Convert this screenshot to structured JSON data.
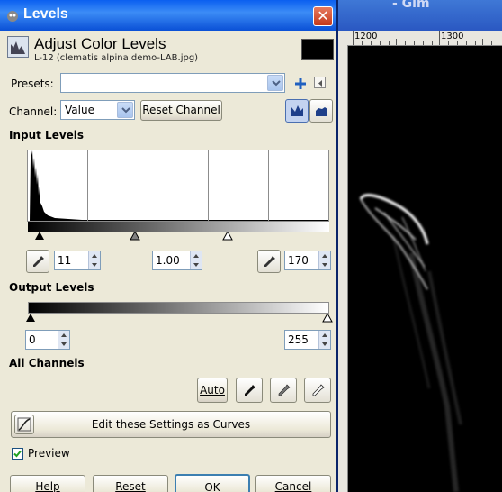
{
  "window": {
    "title": "Levels",
    "close": "✕"
  },
  "header": {
    "title": "Adjust Color Levels",
    "subtitle": "L-12 (clematis alpina demo-LAB.jpg)"
  },
  "presets": {
    "label": "Presets:",
    "value": ""
  },
  "channel": {
    "label": "Channel:",
    "value": "Value",
    "reset_label": "Reset Channel"
  },
  "input_levels": {
    "heading": "Input Levels",
    "low": "11",
    "gamma": "1.00",
    "high": "170"
  },
  "output_levels": {
    "heading": "Output Levels",
    "low": "0",
    "high": "255"
  },
  "all_channels": {
    "heading": "All Channels",
    "auto_label": "Auto"
  },
  "curves_button": {
    "label": "Edit these Settings as Curves"
  },
  "preview": {
    "label": "Preview",
    "checked": true
  },
  "buttons": {
    "help": "Help",
    "reset": "Reset",
    "ok": "OK",
    "cancel": "Cancel"
  },
  "canvas_window": {
    "title_fragment": "- Gim",
    "ruler_labels": [
      "1200",
      "1300"
    ]
  }
}
